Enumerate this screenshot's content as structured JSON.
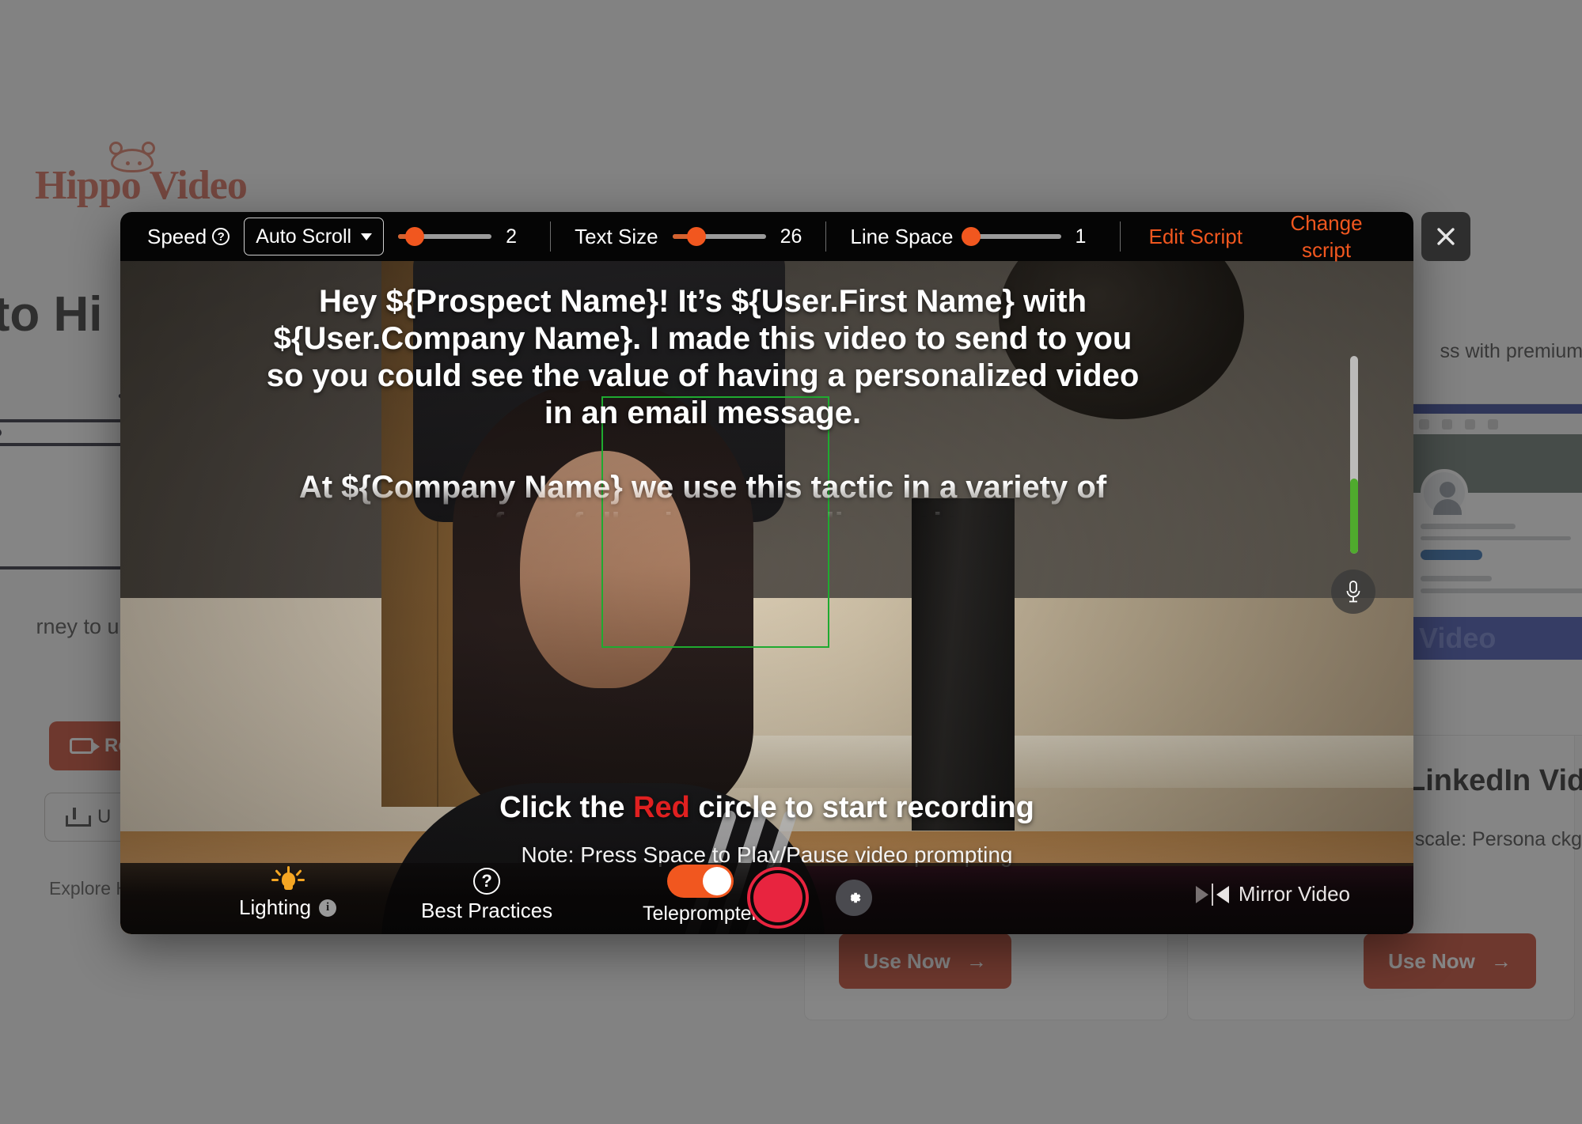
{
  "background": {
    "logo_text": "Hippo Video",
    "heading": "e to Hi",
    "subtext": "rney to uplift vid",
    "record_button": "Re",
    "upload_button": "U",
    "explore_link": "Explore H",
    "right_headline": "ss with premium vid",
    "card_banner": "Video",
    "right_card_title": "LinkedIn Vid",
    "right_card_body": "at scale: Persona ckgrounds for Em",
    "use_now_label": "Use Now",
    "use_now_arrow": "→"
  },
  "toolbar": {
    "speed": {
      "label": "Speed",
      "help_icon": "question-mark-icon",
      "mode": "Auto Scroll",
      "value": "2",
      "fill_percent": 18
    },
    "text_size": {
      "label": "Text Size",
      "value": "26",
      "fill_percent": 26
    },
    "line_space": {
      "label": "Line Space",
      "value": "1",
      "fill_percent": 4
    },
    "edit_script": "Edit Script",
    "change_script": "Change script",
    "accent_color": "#f1571f"
  },
  "prompter": {
    "paragraph_1": "Hey ${Prospect Name}! It’s ${User.First Name} with ${User.Company Name}. I made this video to send to you so you could see the value of having a personalized video in an email message.",
    "paragraph_2": "At ${Company Name} we use this tactic in a variety of ways from following up on discussions"
  },
  "hints": {
    "main_prefix": "Click the ",
    "main_red": "Red",
    "main_suffix": " circle to start recording",
    "note": "Note: Press Space to Play/Pause video prompting"
  },
  "audio": {
    "meter_level_percent": 38,
    "meter_color": "#4faa2d",
    "mic_icon": "microphone-icon"
  },
  "bottom_bar": {
    "lighting_label": "Lighting",
    "lighting_icon": "lightbulb-icon",
    "lighting_info_icon": "info-icon",
    "best_practices_label": "Best Practices",
    "best_practices_icon": "question-circle-icon",
    "teleprompter_label": "Teleprompter",
    "teleprompter_on": true,
    "record_icon": "record-circle-icon",
    "settings_icon": "gear-icon",
    "mirror_label": "Mirror Video",
    "mirror_icon": "mirror-flip-icon"
  },
  "close": {
    "icon": "close-icon"
  }
}
